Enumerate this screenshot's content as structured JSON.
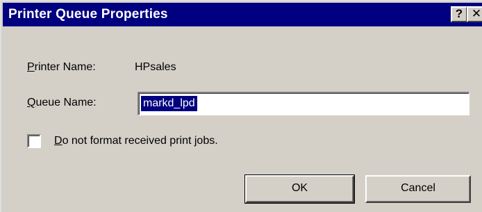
{
  "window": {
    "title": "Printer Queue Properties",
    "help_glyph": "?",
    "close_glyph": "✕"
  },
  "form": {
    "printer_name_label_mnemonic": "P",
    "printer_name_label_rest": "rinter Name:",
    "printer_name_value": "HPsales",
    "queue_name_label_mnemonic": "Q",
    "queue_name_label_rest": "ueue Name:",
    "queue_name_value": "markd_lpd",
    "checkbox_label_mnemonic": "D",
    "checkbox_label_rest": "o not format received print jobs.",
    "checkbox_checked": false
  },
  "buttons": {
    "ok": "OK",
    "cancel": "Cancel"
  },
  "colors": {
    "titlebar": "#000080",
    "face": "#d4d0c8",
    "selection": "#000080"
  },
  "icons": [
    "help-icon",
    "close-icon"
  ]
}
